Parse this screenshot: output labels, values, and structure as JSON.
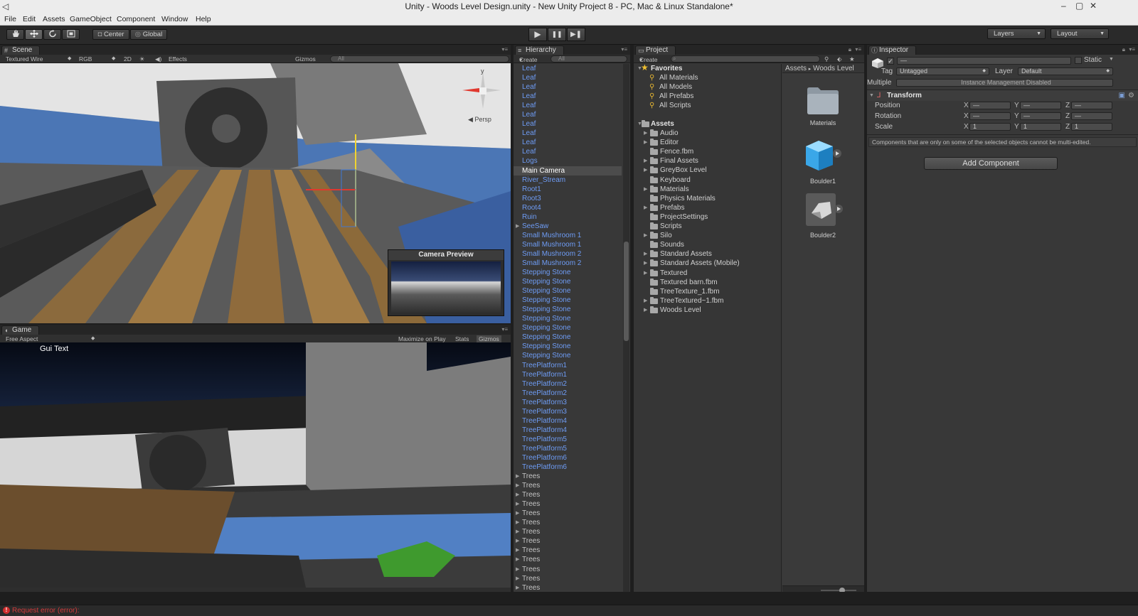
{
  "window": {
    "title": "Unity - Woods Level Design.unity - New Unity Project 8 - PC, Mac & Linux Standalone*",
    "controls": [
      "–",
      "▢",
      "✕"
    ]
  },
  "menu": [
    "File",
    "Edit",
    "Assets",
    "GameObject",
    "Component",
    "Window",
    "Help"
  ],
  "toolbar": {
    "tools": [
      "hand-icon",
      "move-icon",
      "rotate-icon",
      "scale-icon"
    ],
    "pivot_center": "Center",
    "pivot_global": "Global",
    "play": "▶",
    "pause": "❚❚",
    "step": "▶❚",
    "layers": "Layers",
    "layout": "Layout"
  },
  "scene": {
    "tab": "Scene",
    "shading": "Textured Wire",
    "render_mode": "RGB",
    "mode_2d": "2D",
    "effects": "Effects",
    "gizmos": "Gizmos",
    "search_placeholder": "All",
    "persp": "Persp",
    "gizmo_y": "y",
    "camera_preview": "Camera Preview"
  },
  "game": {
    "tab": "Game",
    "aspect": "Free Aspect",
    "maximize_on_play": "Maximize on Play",
    "stats": "Stats",
    "gizmos": "Gizmos",
    "gui_text": "Gui Text"
  },
  "hierarchy": {
    "tab": "Hierarchy",
    "create": "Create",
    "search_placeholder": "All",
    "items": [
      {
        "label": "Leaf",
        "type": "prefab"
      },
      {
        "label": "Leaf",
        "type": "prefab"
      },
      {
        "label": "Leaf",
        "type": "prefab"
      },
      {
        "label": "Leaf",
        "type": "prefab"
      },
      {
        "label": "Leaf",
        "type": "prefab"
      },
      {
        "label": "Leaf",
        "type": "prefab"
      },
      {
        "label": "Leaf",
        "type": "prefab"
      },
      {
        "label": "Leaf",
        "type": "prefab"
      },
      {
        "label": "Leaf",
        "type": "prefab"
      },
      {
        "label": "Leaf",
        "type": "prefab"
      },
      {
        "label": "Logs",
        "type": "prefab"
      },
      {
        "label": "Main Camera",
        "type": "selected"
      },
      {
        "label": "River_Stream",
        "type": "prefab"
      },
      {
        "label": "Root1",
        "type": "prefab"
      },
      {
        "label": "Root3",
        "type": "prefab"
      },
      {
        "label": "Root4",
        "type": "prefab"
      },
      {
        "label": "Ruin",
        "type": "prefab"
      },
      {
        "label": "SeeSaw",
        "type": "prefab-expand"
      },
      {
        "label": "Small Mushroom 1",
        "type": "prefab"
      },
      {
        "label": "Small Mushroom 1",
        "type": "prefab"
      },
      {
        "label": "Small Mushroom 2",
        "type": "prefab"
      },
      {
        "label": "Small Mushroom 2",
        "type": "prefab"
      },
      {
        "label": "Stepping Stone",
        "type": "prefab"
      },
      {
        "label": "Stepping Stone",
        "type": "prefab"
      },
      {
        "label": "Stepping Stone",
        "type": "prefab"
      },
      {
        "label": "Stepping Stone",
        "type": "prefab"
      },
      {
        "label": "Stepping Stone",
        "type": "prefab"
      },
      {
        "label": "Stepping Stone",
        "type": "prefab"
      },
      {
        "label": "Stepping Stone",
        "type": "prefab"
      },
      {
        "label": "Stepping Stone",
        "type": "prefab"
      },
      {
        "label": "Stepping Stone",
        "type": "prefab"
      },
      {
        "label": "Stepping Stone",
        "type": "prefab"
      },
      {
        "label": "TreePlatform1",
        "type": "prefab"
      },
      {
        "label": "TreePlatform1",
        "type": "prefab"
      },
      {
        "label": "TreePlatform2",
        "type": "prefab"
      },
      {
        "label": "TreePlatform2",
        "type": "prefab"
      },
      {
        "label": "TreePlatform3",
        "type": "prefab"
      },
      {
        "label": "TreePlatform3",
        "type": "prefab"
      },
      {
        "label": "TreePlatform4",
        "type": "prefab"
      },
      {
        "label": "TreePlatform4",
        "type": "prefab"
      },
      {
        "label": "TreePlatform5",
        "type": "prefab"
      },
      {
        "label": "TreePlatform5",
        "type": "prefab"
      },
      {
        "label": "TreePlatform6",
        "type": "prefab"
      },
      {
        "label": "TreePlatform6",
        "type": "prefab"
      },
      {
        "label": "Trees",
        "type": "expand"
      },
      {
        "label": "Trees",
        "type": "expand"
      },
      {
        "label": "Trees",
        "type": "expand"
      },
      {
        "label": "Trees",
        "type": "expand"
      },
      {
        "label": "Trees",
        "type": "expand"
      },
      {
        "label": "Trees",
        "type": "expand"
      },
      {
        "label": "Trees",
        "type": "expand"
      },
      {
        "label": "Trees",
        "type": "expand"
      },
      {
        "label": "Trees",
        "type": "expand"
      },
      {
        "label": "Trees",
        "type": "expand"
      },
      {
        "label": "Trees",
        "type": "expand"
      },
      {
        "label": "Trees",
        "type": "expand"
      },
      {
        "label": "Trees",
        "type": "expand"
      }
    ]
  },
  "project": {
    "tab": "Project",
    "create": "Create",
    "favorites_label": "Favorites",
    "favorites": [
      "All Materials",
      "All Models",
      "All Prefabs",
      "All Scripts"
    ],
    "assets_label": "Assets",
    "folders": [
      {
        "label": "Audio",
        "expand": true
      },
      {
        "label": "Editor",
        "expand": true
      },
      {
        "label": "Fence.fbm",
        "expand": false
      },
      {
        "label": "Final Assets",
        "expand": true
      },
      {
        "label": "GreyBox Level",
        "expand": true
      },
      {
        "label": "Keyboard",
        "expand": false
      },
      {
        "label": "Materials",
        "expand": true
      },
      {
        "label": "Physics Materials",
        "expand": false
      },
      {
        "label": "Prefabs",
        "expand": true
      },
      {
        "label": "ProjectSettings",
        "expand": false
      },
      {
        "label": "Scripts",
        "expand": false
      },
      {
        "label": "Silo",
        "expand": true
      },
      {
        "label": "Sounds",
        "expand": false
      },
      {
        "label": "Standard Assets",
        "expand": true
      },
      {
        "label": "Standard Assets (Mobile)",
        "expand": true
      },
      {
        "label": "Textured",
        "expand": true
      },
      {
        "label": "Textured barn.fbm",
        "expand": false
      },
      {
        "label": "TreeTexture_1.fbm",
        "expand": false
      },
      {
        "label": "TreeTextured~1.fbm",
        "expand": true
      },
      {
        "label": "Woods Level",
        "expand": true
      }
    ],
    "breadcrumb_root": "Assets",
    "breadcrumb_sep": "▸",
    "breadcrumb_leaf": "Woods Level",
    "grid_items": [
      {
        "label": "Materials",
        "icon": "folder-icon"
      },
      {
        "label": "Boulder1",
        "icon": "prefab-cube-icon"
      },
      {
        "label": "Boulder2",
        "icon": "model-icon"
      }
    ]
  },
  "inspector": {
    "tab": "Inspector",
    "name_value": "—",
    "static_label": "Static",
    "tag_label": "Tag",
    "tag_value": "Untagged",
    "layer_label": "Layer",
    "layer_value": "Default",
    "multiple_label": "Multiple",
    "instance_management": "Instance Management Disabled",
    "transform_label": "Transform",
    "position_label": "Position",
    "rotation_label": "Rotation",
    "scale_label": "Scale",
    "axis_x": "X",
    "axis_y": "Y",
    "axis_z": "Z",
    "position": [
      "—",
      "—",
      "—"
    ],
    "rotation": [
      "—",
      "—",
      "—"
    ],
    "scale": [
      "1",
      "1",
      "1"
    ],
    "multi_edit_note": "Components that are only on some of the selected objects cannot be multi-edited.",
    "add_component": "Add Component"
  },
  "status": {
    "icon": "!",
    "message": "Request error (error):"
  },
  "colors": {
    "prefab_blue": "#6e9cf5",
    "error_red": "#d23c3c",
    "panel_bg": "#383838"
  }
}
